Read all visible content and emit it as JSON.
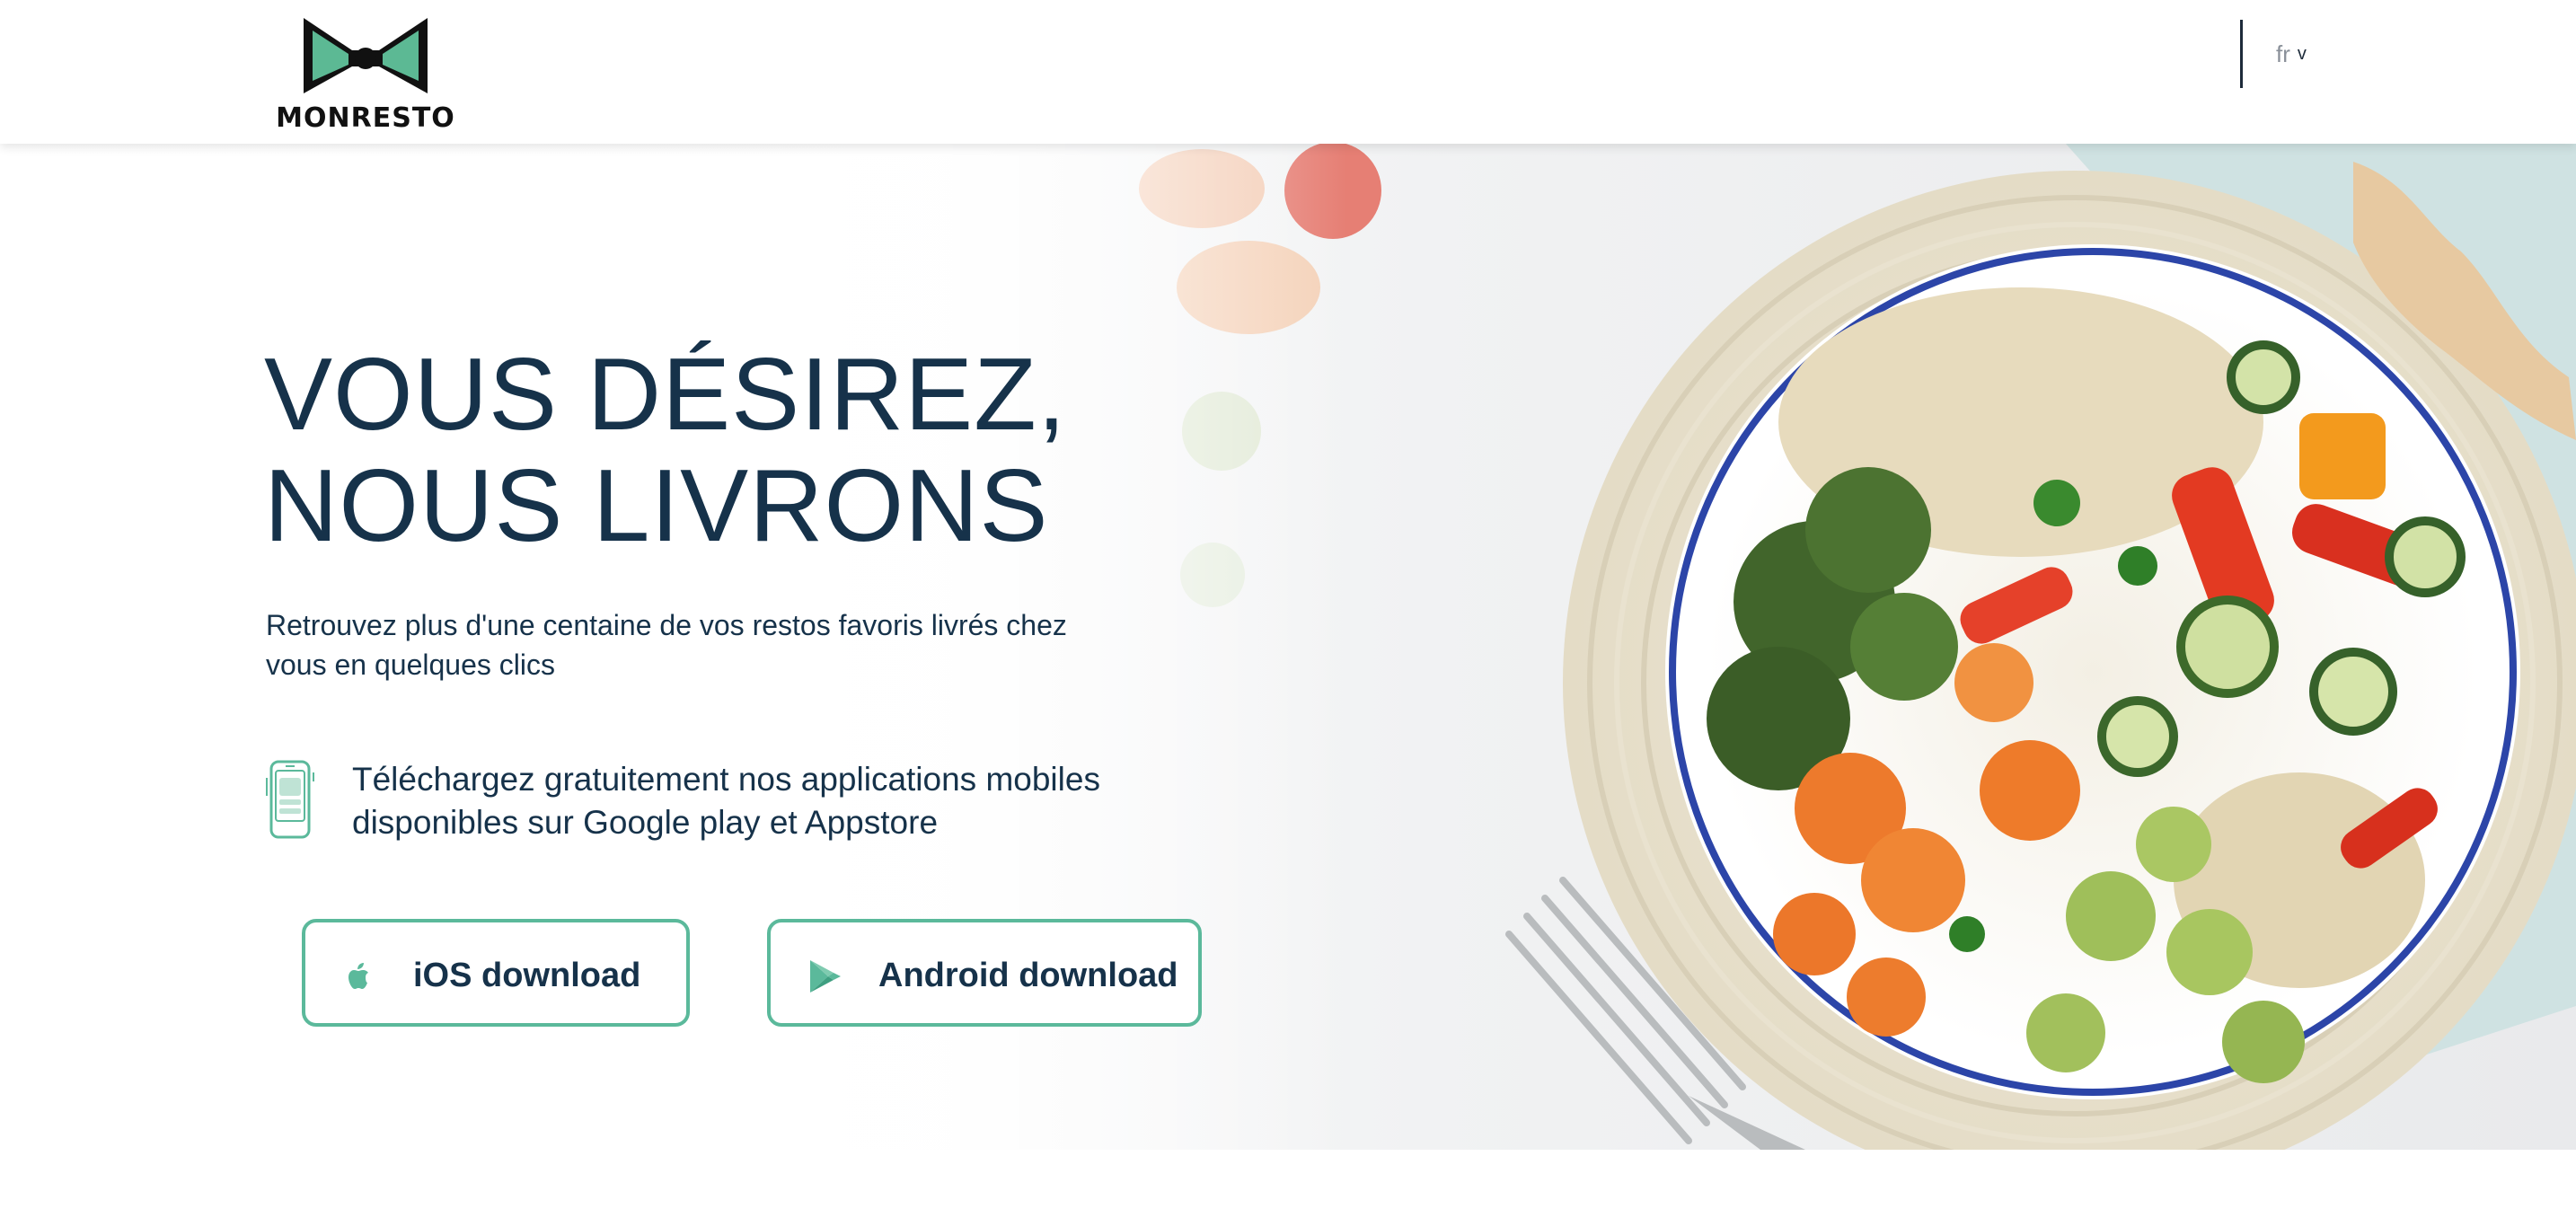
{
  "header": {
    "logo_text": "MONRESTO",
    "language": {
      "current": "fr",
      "chevron": "v"
    }
  },
  "hero": {
    "headline_line1": "VOUS DÉSIREZ,",
    "headline_line2": "NOUS LIVRONS",
    "subtitle_line1": "Retrouvez plus d'une centaine de vos restos favoris livrés chez",
    "subtitle_line2": "vous en quelques clics",
    "download_text_line1": "Téléchargez gratuitement nos applications mobiles",
    "download_text_line2": "disponibles sur Google play et Appstore",
    "buttons": {
      "ios_label": "iOS download",
      "android_label": "Android download"
    }
  },
  "icons": {
    "logo": "bowtie-logo-icon",
    "phone": "smartphone-icon",
    "ios": "apple-icon",
    "android": "google-play-icon"
  },
  "colors": {
    "primary_text": "#16324a",
    "accent_green": "#5bb99b",
    "logo_green": "#5cb994"
  }
}
